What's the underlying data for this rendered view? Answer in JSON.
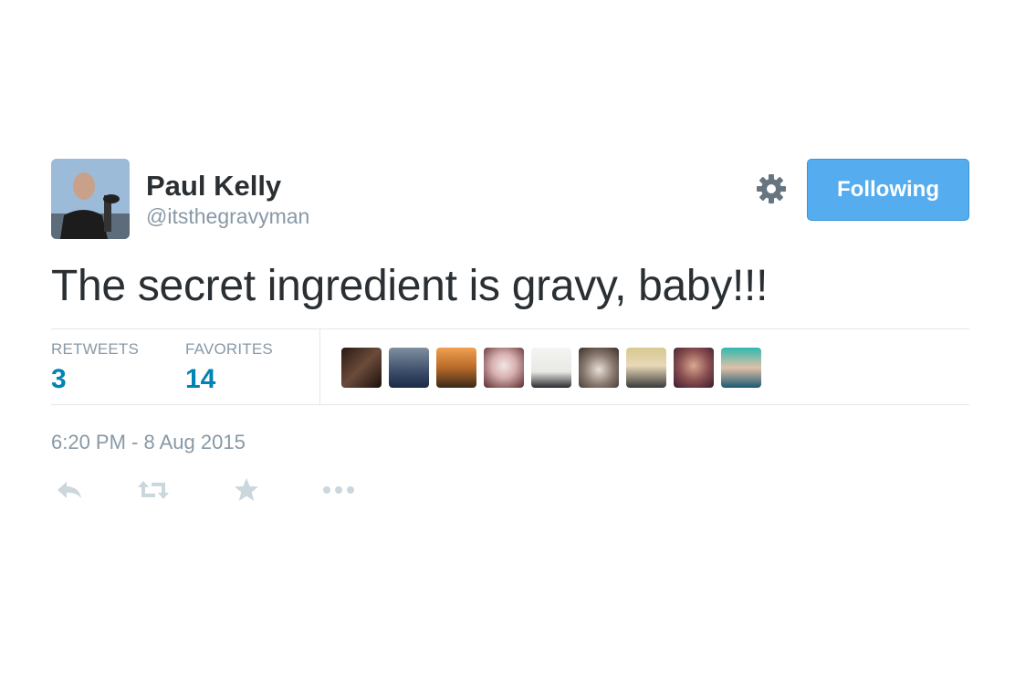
{
  "author": {
    "name": "Paul Kelly",
    "handle": "@itsthegravyman"
  },
  "follow_button": {
    "label": "Following"
  },
  "tweet": {
    "text": "The secret ingredient is gravy, baby!!!",
    "timestamp": "6:20 PM - 8 Aug 2015"
  },
  "stats": {
    "retweets_label": "RETWEETS",
    "retweets_count": "3",
    "favorites_label": "FAVORITES",
    "favorites_count": "14"
  },
  "favoriters_count_shown": 9,
  "icons": {
    "settings": "gear-icon",
    "reply": "reply-icon",
    "retweet": "retweet-icon",
    "favorite": "star-icon",
    "more": "more-dots-icon"
  },
  "colors": {
    "follow_button_bg": "#55acee",
    "stat_value": "#0084b4",
    "muted_text": "#8899a6",
    "divider": "#e1e8ed"
  }
}
